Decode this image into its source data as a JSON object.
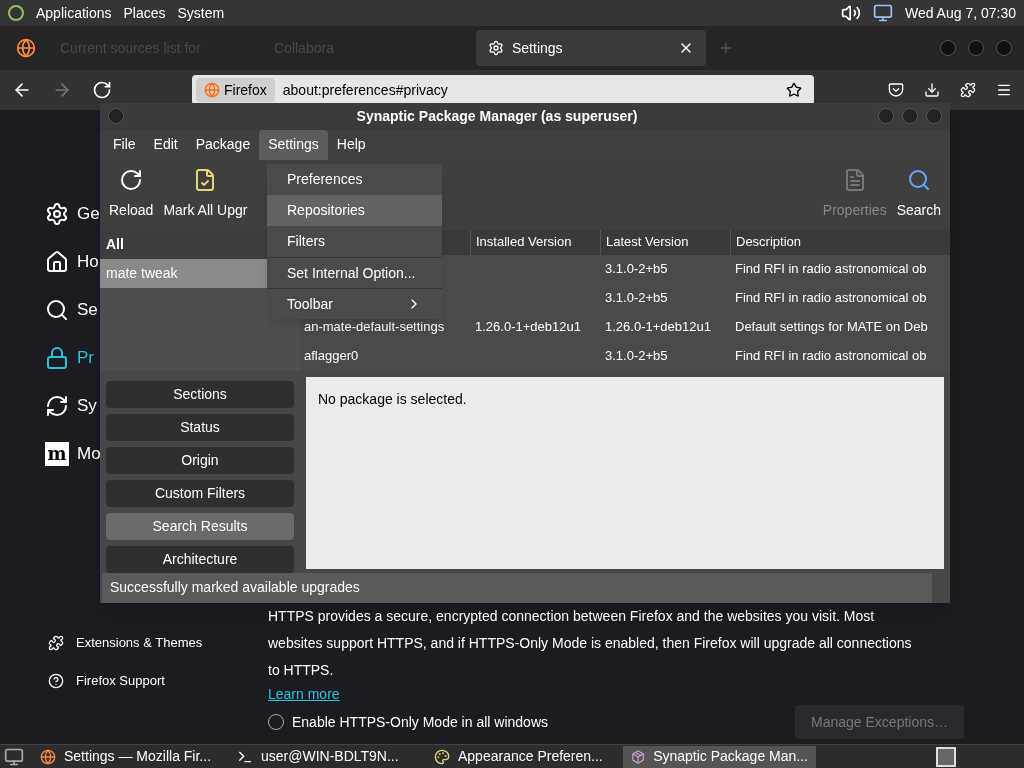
{
  "top_panel": {
    "menus": [
      "Applications",
      "Places",
      "System"
    ],
    "clock": "Wed Aug 7, 07:30"
  },
  "browser": {
    "tabs": [
      {
        "label": "Current sources list for",
        "selected": false
      },
      {
        "label": "Collabora",
        "selected": false
      },
      {
        "label": "Settings",
        "selected": true
      }
    ],
    "identity": "Firefox",
    "url": "about:preferences#privacy",
    "sidebar": [
      {
        "label": "Ge",
        "kind": "gear",
        "selected": false
      },
      {
        "label": "Ho",
        "kind": "home",
        "selected": false
      },
      {
        "label": "Se",
        "kind": "search",
        "selected": false
      },
      {
        "label": "Pr",
        "kind": "lock",
        "selected": true
      },
      {
        "label": "Sy",
        "kind": "sync",
        "selected": false
      },
      {
        "label": "Mo",
        "kind": "logo",
        "logo": "m",
        "selected": false
      }
    ],
    "sidebar_footer": [
      {
        "label": "Extensions & Themes",
        "kind": "puzzle"
      },
      {
        "label": "Firefox Support",
        "kind": "help"
      }
    ],
    "https": {
      "paragraph": "HTTPS provides a secure, encrypted connection between Firefox and the websites you visit. Most websites support HTTPS, and if HTTPS-Only Mode is enabled, then Firefox will upgrade all connections to HTTPS.",
      "link": "Learn more",
      "options": [
        {
          "label": "Enable HTTPS-Only Mode in all windows",
          "selected": false
        }
      ],
      "button": {
        "label": "Manage Exceptions…",
        "disabled": true
      }
    }
  },
  "synaptic": {
    "title": "Synaptic Package Manager  (as superuser)",
    "menubar": [
      {
        "label": "File",
        "open": false
      },
      {
        "label": "Edit",
        "open": false
      },
      {
        "label": "Package",
        "open": false
      },
      {
        "label": "Settings",
        "open": true
      },
      {
        "label": "Help",
        "open": false
      }
    ],
    "menu_items": [
      {
        "label": "Preferences",
        "selected": false,
        "submenu": false
      },
      {
        "label": "Repositories",
        "selected": true,
        "submenu": false
      },
      {
        "label": "Filters",
        "selected": false,
        "submenu": false
      },
      {
        "label": "Set Internal Option...",
        "selected": false,
        "submenu": false
      },
      {
        "label": "Toolbar",
        "selected": false,
        "submenu": true
      }
    ],
    "toolbar": [
      {
        "label": "Reload",
        "kind": "reload",
        "disabled": false
      },
      {
        "label": "Mark All Upgr",
        "kind": "mark",
        "disabled": false
      },
      {
        "label": "Properties",
        "kind": "properties",
        "disabled": true
      },
      {
        "label": "Search",
        "kind": "search",
        "disabled": false
      }
    ],
    "filters": [
      {
        "label": "All",
        "selected": false
      },
      {
        "label": "mate tweak",
        "selected": true
      }
    ],
    "columns": [
      "Installed Version",
      "Latest Version",
      "Description"
    ],
    "rows": [
      {
        "latest": "3.1.0-2+b5",
        "description": "Find RFI in radio astronomical ob"
      },
      {
        "latest": "3.1.0-2+b5",
        "description": "Find RFI in radio astronomical ob"
      },
      {
        "name": "an-mate-default-settings",
        "installed": "1.26.0-1+deb12u1",
        "latest": "1.26.0-1+deb12u1",
        "description": "Default settings for MATE on Deb"
      },
      {
        "name": "aflagger0",
        "latest": "3.1.0-2+b5",
        "description": "Find RFI in radio astronomical ob"
      }
    ],
    "filter_buttons": [
      {
        "label": "Sections",
        "selected": false
      },
      {
        "label": "Status",
        "selected": false
      },
      {
        "label": "Origin",
        "selected": false
      },
      {
        "label": "Custom Filters",
        "selected": false
      },
      {
        "label": "Search Results",
        "selected": true
      },
      {
        "label": "Architecture",
        "selected": false
      }
    ],
    "details": "No package is selected.",
    "status": "Successfully marked available upgrades"
  },
  "taskbar": {
    "items": [
      {
        "label": "Settings — Mozilla Fir...",
        "kind": "browser",
        "selected": false
      },
      {
        "label": "user@WIN-BDLT9N...",
        "kind": "terminal",
        "selected": false
      },
      {
        "label": "Appearance Preferen...",
        "kind": "appearance",
        "selected": false
      },
      {
        "label": "Synaptic Package Man...",
        "kind": "package",
        "selected": true
      }
    ]
  }
}
